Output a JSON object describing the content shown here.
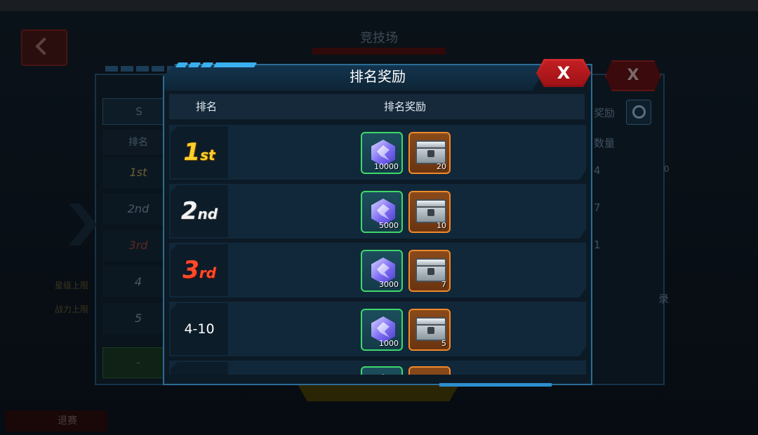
{
  "background": {
    "title": "竞技场",
    "tab_s": "S",
    "col_rank": "排名",
    "ranks": [
      "1st",
      "2nd",
      "3rd",
      "4",
      "5"
    ],
    "bottom_rank": "-",
    "right_reward": "奖励",
    "right_count": "数量",
    "right_values": [
      "4",
      "7",
      "1"
    ],
    "right_extra": "0",
    "right_record": "录",
    "close_label": "X",
    "exit_label": "退赛",
    "left_star": "星级上限",
    "left_power": "战力上限"
  },
  "modal": {
    "title": "排名奖励",
    "close_label": "X",
    "columns": {
      "rank": "排名",
      "reward": "排名奖励"
    },
    "rows": [
      {
        "rank_main": "1",
        "rank_suffix": "st",
        "rank_style": "r1",
        "crystal_count": "10000",
        "box_count": "20"
      },
      {
        "rank_main": "2",
        "rank_suffix": "nd",
        "rank_style": "r2",
        "crystal_count": "5000",
        "box_count": "10"
      },
      {
        "rank_main": "3",
        "rank_suffix": "rd",
        "rank_style": "r3",
        "crystal_count": "3000",
        "box_count": "7"
      },
      {
        "rank_main": "4-10",
        "rank_suffix": "",
        "rank_style": "plain",
        "crystal_count": "1000",
        "box_count": "5"
      },
      {
        "rank_main": "",
        "rank_suffix": "",
        "rank_style": "plain",
        "crystal_count": "",
        "box_count": ""
      }
    ],
    "icons": {
      "crystal": "purple-crystal-icon",
      "box": "silver-chest-icon"
    }
  },
  "colors": {
    "accent": "#3ab0ef",
    "close_red": "#c01f22",
    "gold": "#ffd12a",
    "bronze": "#ff4a2a"
  }
}
